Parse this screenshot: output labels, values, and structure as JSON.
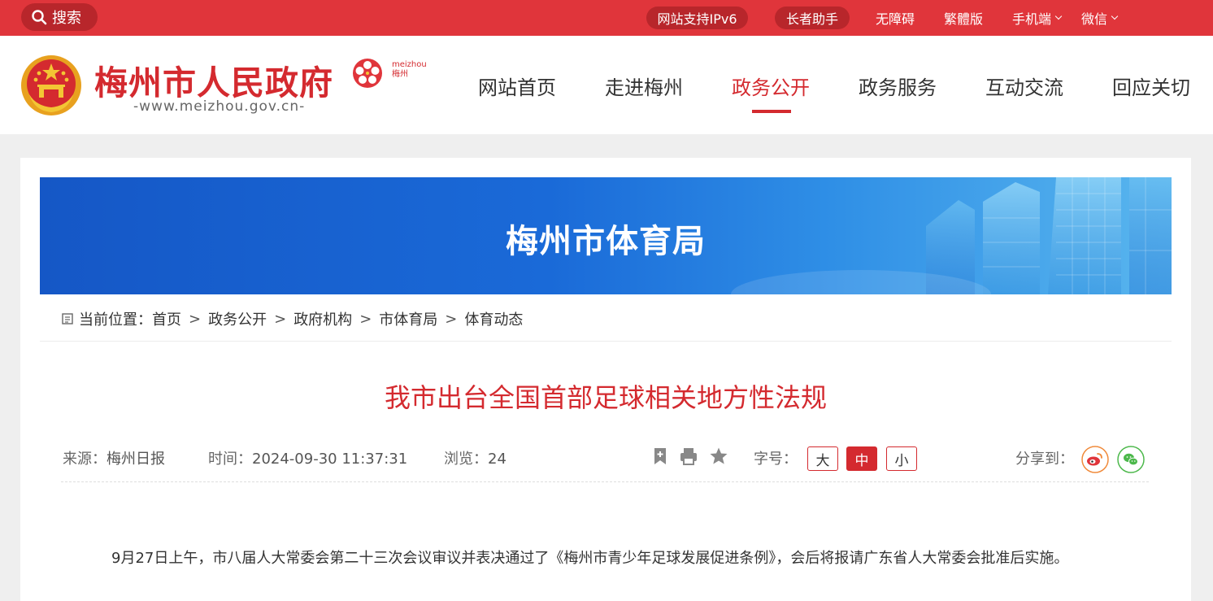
{
  "topbar": {
    "search_label": "搜索",
    "ipv6": "网站支持IPv6",
    "elder": "长者助手",
    "accessibility": "无障碍",
    "traditional": "繁體版",
    "mobile": "手机端",
    "wechat": "微信"
  },
  "header": {
    "site_name": "梅州市人民政府",
    "site_url": "-www.meizhou.gov.cn-",
    "city_logo_en": "meizhou",
    "city_logo_cn": "梅州",
    "nav": [
      "网站首页",
      "走进梅州",
      "政务公开",
      "政务服务",
      "互动交流",
      "回应关切"
    ],
    "active_nav": "政务公开"
  },
  "banner": {
    "title": "梅州市体育局"
  },
  "breadcrumb": {
    "label": "当前位置：",
    "items": [
      "首页",
      "政务公开",
      "政府机构",
      "市体育局",
      "体育动态"
    ],
    "separator": ">"
  },
  "article": {
    "title": "我市出台全国首部足球相关地方性法规",
    "source_label": "来源：",
    "source": "梅州日报",
    "time_label": "时间：",
    "time": "2024-09-30 11:37:31",
    "views_label": "浏览：",
    "views": "24",
    "fontsize_label": "字号：",
    "fontsize_options": [
      "大",
      "中",
      "小"
    ],
    "fontsize_selected": "中",
    "share_label": "分享到：",
    "paragraph": "9月27日上午，市八届人大常委会第二十三次会议审议并表决通过了《梅州市青少年足球发展促进条例》，会后将报请广东省人大常委会批准后实施。"
  },
  "colors": {
    "brand_red": "#e0353b",
    "title_red": "#d42a2f",
    "banner_blue": "#1a6ad8"
  },
  "icons": [
    "search-icon",
    "bookmark-icon",
    "print-icon",
    "star-icon",
    "weibo-icon",
    "wechat-icon",
    "breadcrumb-icon"
  ]
}
